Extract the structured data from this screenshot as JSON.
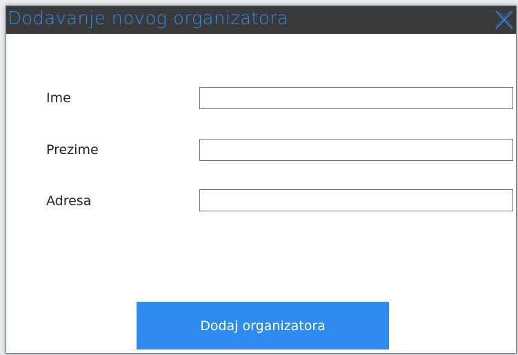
{
  "dialog": {
    "title": "Dodavanje novog organizatora",
    "close_icon": "close-x-icon"
  },
  "form": {
    "fields": [
      {
        "label": "Ime",
        "value": "",
        "placeholder": ""
      },
      {
        "label": "Prezime",
        "value": "",
        "placeholder": ""
      },
      {
        "label": "Adresa",
        "value": "",
        "placeholder": ""
      }
    ],
    "submit_label": "Dodaj organizatora"
  },
  "colors": {
    "titlebar_bg": "#3a3a3a",
    "accent": "#2e8bf0",
    "background": "#ffffff"
  }
}
